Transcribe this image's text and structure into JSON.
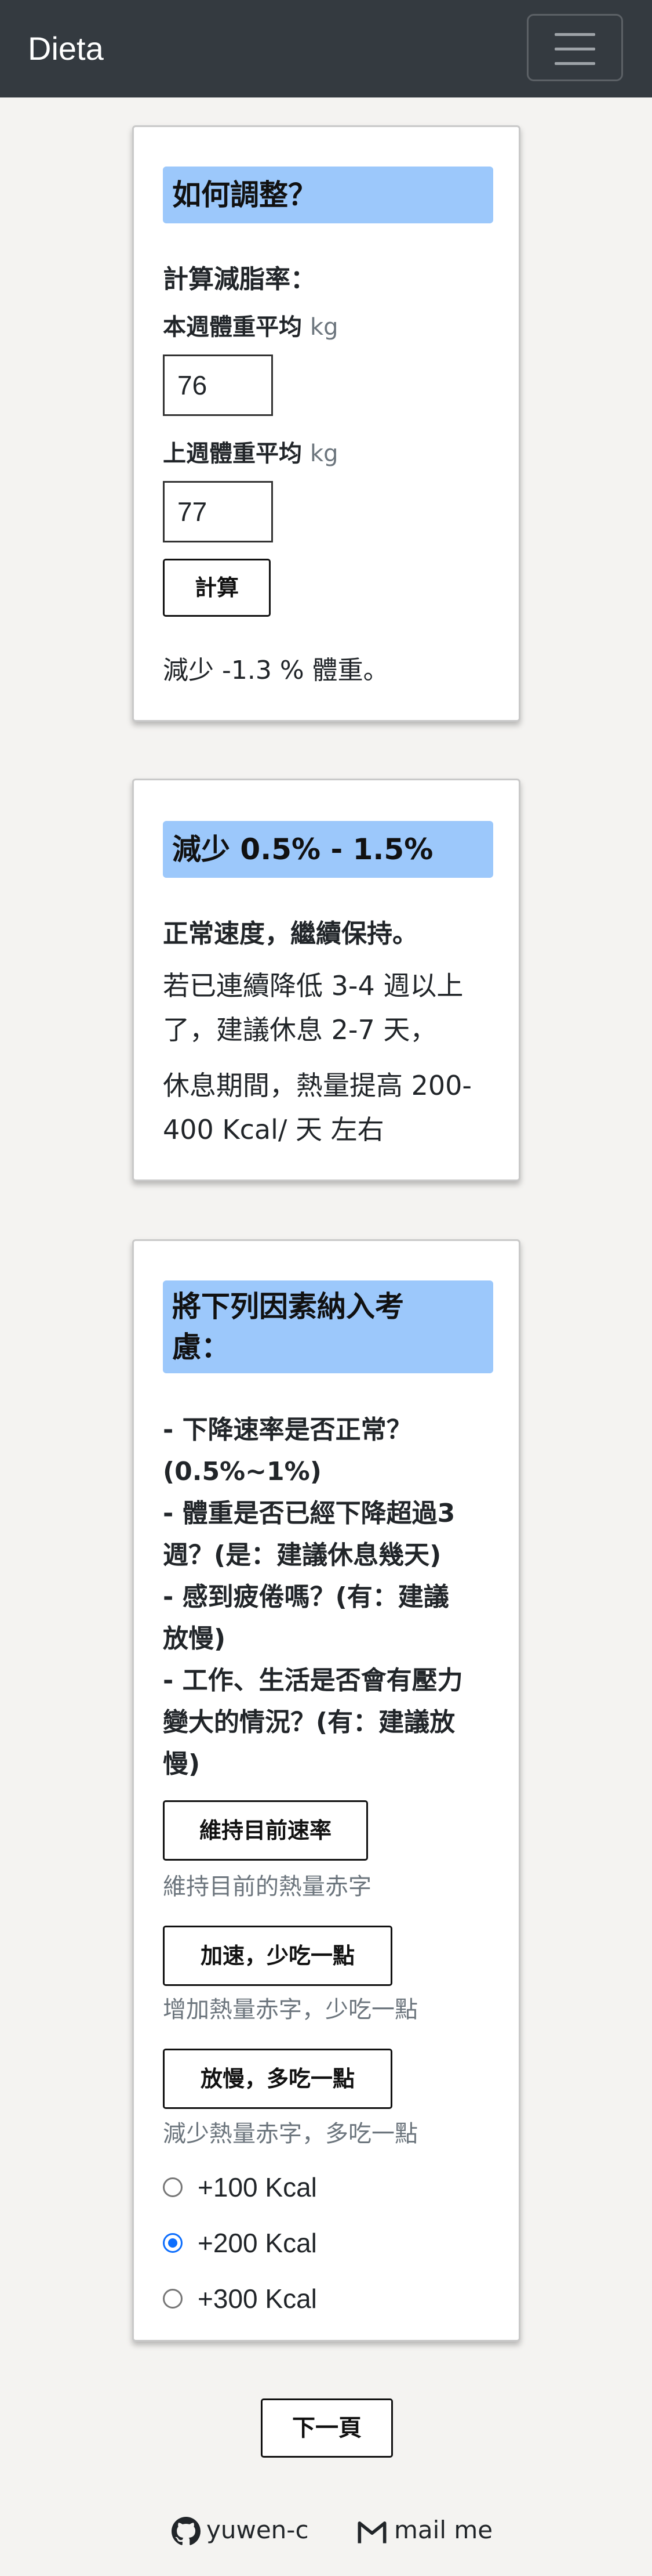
{
  "navbar": {
    "brand": "Dieta",
    "menu_icon": "hamburger-icon"
  },
  "card1": {
    "heading": "如何調整？",
    "calc_label": "計算減脂率：",
    "this_week_label": "本週體重平均",
    "last_week_label": "上週體重平均",
    "unit": "kg",
    "this_week_value": "76",
    "last_week_value": "77",
    "calc_button": "計算",
    "result_text": "減少 -1.3 % 體重。"
  },
  "card2": {
    "heading": "減少 0.5% - 1.5%",
    "status": "正常速度，繼續保持。",
    "para1_line1": "若已連續降低 3-4 週以上",
    "para1_line2": "了，建議休息 2-7 天，",
    "para2_line1": "休息期間，熱量提高 200-",
    "para2_line2": "400 Kcal/ 天 左右"
  },
  "card3": {
    "heading_line1": "將下列因素納入考",
    "heading_line2": "慮：",
    "factors": [
      "- 下降速率是否正常？",
      "(0.5%~1%)",
      "- 體重是否已經下降超過3",
      "週？(是：建議休息幾天)",
      "- 感到疲倦嗎？(有：建議",
      "放慢)",
      "- 工作、生活是否會有壓力",
      "變大的情況？(有：建議放",
      "慢)"
    ],
    "options": [
      {
        "button": "維持目前速率",
        "desc": "維持目前的熱量赤字"
      },
      {
        "button": "加速，少吃一點",
        "desc": "增加熱量赤字，少吃一點"
      },
      {
        "button": "放慢，多吃一點",
        "desc": "減少熱量赤字，多吃一點"
      }
    ],
    "radios": [
      {
        "label": "+100 Kcal",
        "checked": false
      },
      {
        "label": "+200 Kcal",
        "checked": true
      },
      {
        "label": "+300 Kcal",
        "checked": false
      }
    ]
  },
  "next_button": "下一頁",
  "footer": {
    "github_label": "yuwen-c",
    "github_icon": "github-icon",
    "mail_label": "mail me",
    "mail_icon": "gmail-icon"
  },
  "colors": {
    "navbar": "#343a40",
    "highlight": "#9cc8fb",
    "radio_accent": "#0d6efd"
  }
}
